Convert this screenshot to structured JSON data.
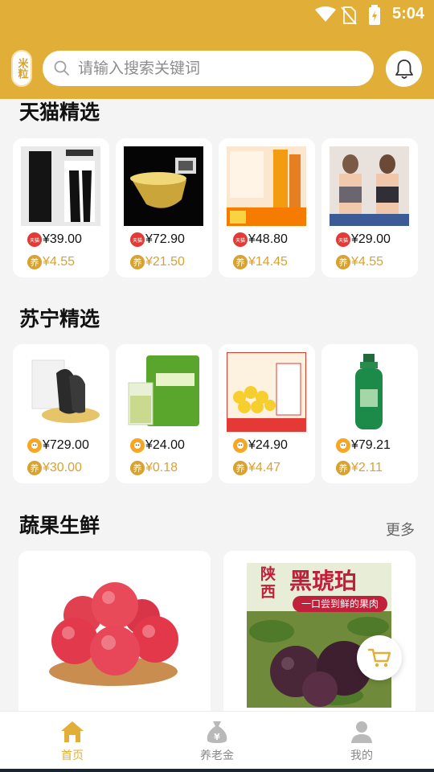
{
  "status_bar": {
    "time": "5:04"
  },
  "header": {
    "logo_text": "米粒",
    "search": {
      "placeholder": "请输入搜索关键词",
      "value": ""
    }
  },
  "sections": {
    "tmall": {
      "title": "天猫精选",
      "badge_color": "#e53935",
      "items": [
        {
          "price": "¥39.00",
          "bonus": "¥4.55",
          "thumb": "black-pants"
        },
        {
          "price": "¥72.90",
          "bonus": "¥21.50",
          "thumb": "gold-bowl"
        },
        {
          "price": "¥48.80",
          "bonus": "¥14.45",
          "thumb": "toothpaste"
        },
        {
          "price": "¥29.00",
          "bonus": "¥4.55",
          "thumb": "bra"
        }
      ]
    },
    "suning": {
      "title": "苏宁精选",
      "badge_color": "#f5a623",
      "items": [
        {
          "price": "¥729.00",
          "bonus": "¥30.00",
          "thumb": "sea-cucumber"
        },
        {
          "price": "¥24.00",
          "bonus": "¥0.18",
          "thumb": "green-tea"
        },
        {
          "price": "¥24.90",
          "bonus": "¥4.47",
          "thumb": "chrysanthemum"
        },
        {
          "price": "¥79.21",
          "bonus": "¥2.11",
          "thumb": "shampoo"
        }
      ]
    },
    "fresh": {
      "title": "蔬果生鲜",
      "more": "更多",
      "items": [
        {
          "thumb": "apples"
        },
        {
          "thumb": "plums",
          "banner_title": "黑琥珀",
          "banner_side": "陕西",
          "banner_sub": "一口尝到鲜的果肉"
        }
      ]
    }
  },
  "bonus_badge": "养",
  "tmall_badge": "天猫",
  "tabbar": [
    {
      "label": "首页",
      "icon": "home-icon",
      "active": true
    },
    {
      "label": "养老金",
      "icon": "money-bag-icon",
      "active": false
    },
    {
      "label": "我的",
      "icon": "user-icon",
      "active": false
    }
  ],
  "colors": {
    "brand": "#e1ae38",
    "bonus": "#d9a22f"
  }
}
